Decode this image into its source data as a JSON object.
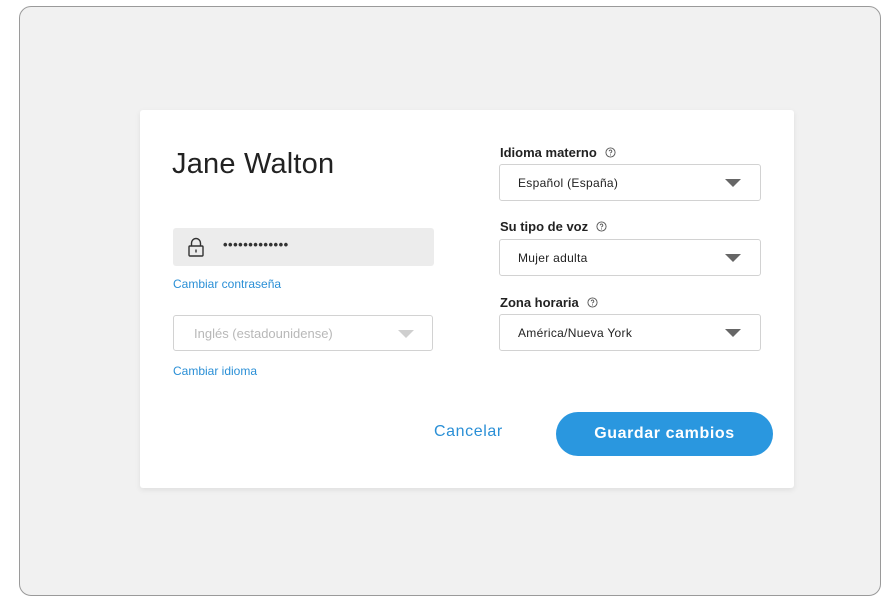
{
  "profile": {
    "name": "Jane Walton",
    "password_mask": "•••••••••••••",
    "change_password_link": "Cambiar contraseña",
    "language_value": "Inglés (estadounidense)",
    "change_language_link": "Cambiar idioma"
  },
  "settings": {
    "native_language": {
      "label": "Idioma materno",
      "value": "Español (España)"
    },
    "voice_type": {
      "label": "Su tipo de voz",
      "value": "Mujer adulta"
    },
    "timezone": {
      "label": "Zona horaria",
      "value": "América/Nueva York"
    }
  },
  "actions": {
    "cancel_label": "Cancelar",
    "save_label": "Guardar cambios"
  },
  "colors": {
    "accent": "#2a97df",
    "link": "#2a8fd6",
    "background": "#f1f1f1"
  },
  "icons": [
    "lock-icon",
    "help-icon",
    "chevron-down-icon"
  ]
}
